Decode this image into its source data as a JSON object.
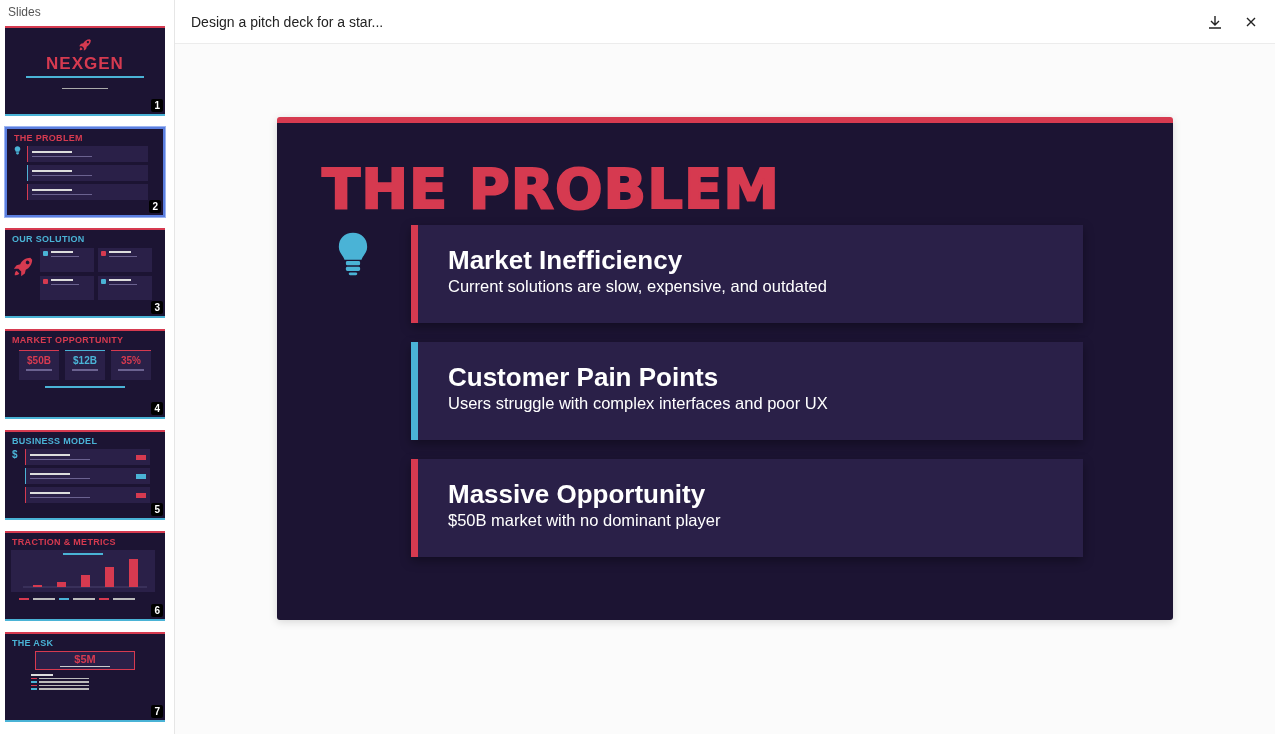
{
  "sidebar": {
    "header": "Slides",
    "slides": [
      {
        "number": "1",
        "kind": "title",
        "selected": false,
        "color": "#d63a50",
        "title": "NEXGEN"
      },
      {
        "number": "2",
        "kind": "list",
        "selected": true,
        "color": "#d63a50",
        "title": "THE PROBLEM",
        "badges": false,
        "items": [
          {
            "color": "#d63a50"
          },
          {
            "color": "#4ab3d6"
          },
          {
            "color": "#d63a50"
          }
        ]
      },
      {
        "number": "3",
        "kind": "cards",
        "selected": false,
        "color": "#4ab3d6",
        "title": "OUR SOLUTION",
        "items": [
          {
            "color": "#4ab3d6"
          },
          {
            "color": "#d63a50"
          },
          {
            "color": "#d63a50"
          },
          {
            "color": "#4ab3d6"
          }
        ]
      },
      {
        "number": "4",
        "kind": "stats",
        "selected": false,
        "color": "#d63a50",
        "title": "MARKET OPPORTUNITY",
        "items": [
          {
            "value": "$50B",
            "color": "#d63a50"
          },
          {
            "value": "$12B",
            "color": "#4ab3d6"
          },
          {
            "value": "35%",
            "color": "#d63a50"
          }
        ]
      },
      {
        "number": "5",
        "kind": "list",
        "selected": false,
        "color": "#4ab3d6",
        "title": "BUSINESS MODEL",
        "symbol": "$",
        "badges": true,
        "items": [
          {
            "color": "#d63a50"
          },
          {
            "color": "#4ab3d6"
          },
          {
            "color": "#d63a50"
          }
        ]
      },
      {
        "number": "6",
        "kind": "chart",
        "selected": false,
        "color": "#d63a50",
        "title": "TRACTION & METRICS",
        "metrics": [
          {
            "color": "#d63a50"
          },
          {
            "color": "#4ab3d6"
          },
          {
            "color": "#d63a50"
          }
        ]
      },
      {
        "number": "7",
        "kind": "ask",
        "selected": false,
        "color": "#4ab3d6",
        "title": "THE ASK",
        "amount": "$5M",
        "items": [
          {
            "color": "#d63a50"
          },
          {
            "color": "#4ab3d6"
          },
          {
            "color": "#d63a50"
          },
          {
            "color": "#4ab3d6"
          }
        ]
      }
    ]
  },
  "topbar": {
    "title": "Design a pitch deck for a star..."
  },
  "slide": {
    "title": "THE PROBLEM",
    "color": "#d63a50",
    "points": [
      {
        "heading": "Market Inefficiency",
        "text": "Current solutions are slow, expensive, and outdated",
        "color": "#d63a50"
      },
      {
        "heading": "Customer Pain Points",
        "text": "Users struggle with complex interfaces and poor UX",
        "color": "#4ab3d6"
      },
      {
        "heading": "Massive Opportunity",
        "text": "$50B market with no dominant player",
        "color": "#d63a50"
      }
    ]
  }
}
